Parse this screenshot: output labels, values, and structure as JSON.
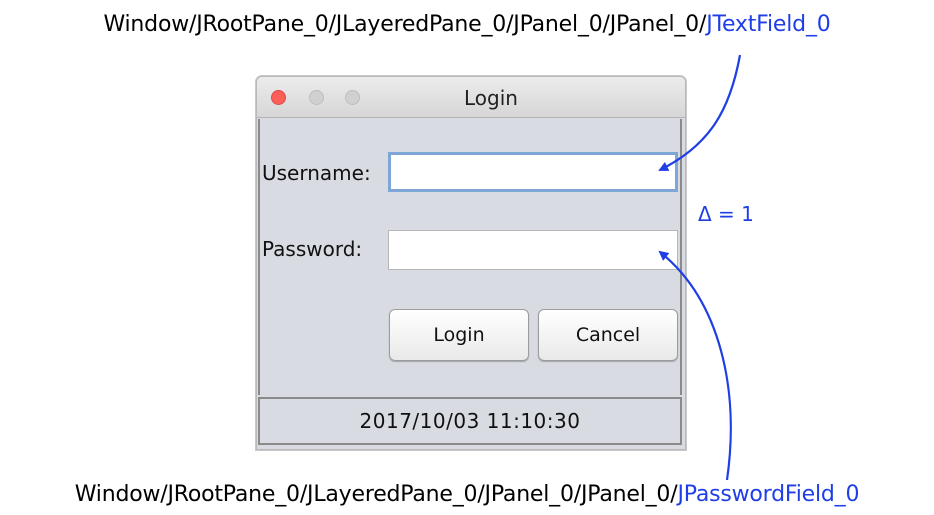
{
  "top_path": {
    "prefix": "Window/JRootPane_0/JLayeredPane_0/JPanel_0/JPanel_0/",
    "target": "JTextField_0"
  },
  "bottom_path": {
    "prefix": "Window/JRootPane_0/JLayeredPane_0/JPanel_0/JPanel_0/",
    "target": "JPasswordField_0"
  },
  "delta": "Δ = 1",
  "window": {
    "title": "Login",
    "username_label": "Username:",
    "password_label": "Password:",
    "username_value": "",
    "password_value": "",
    "login_label": "Login",
    "cancel_label": "Cancel",
    "status": "2017/10/03 11:10:30"
  },
  "colors": {
    "highlight": "#1f3ee6",
    "close_light": "#fc5f57",
    "focus_border": "#7ea7d8"
  }
}
